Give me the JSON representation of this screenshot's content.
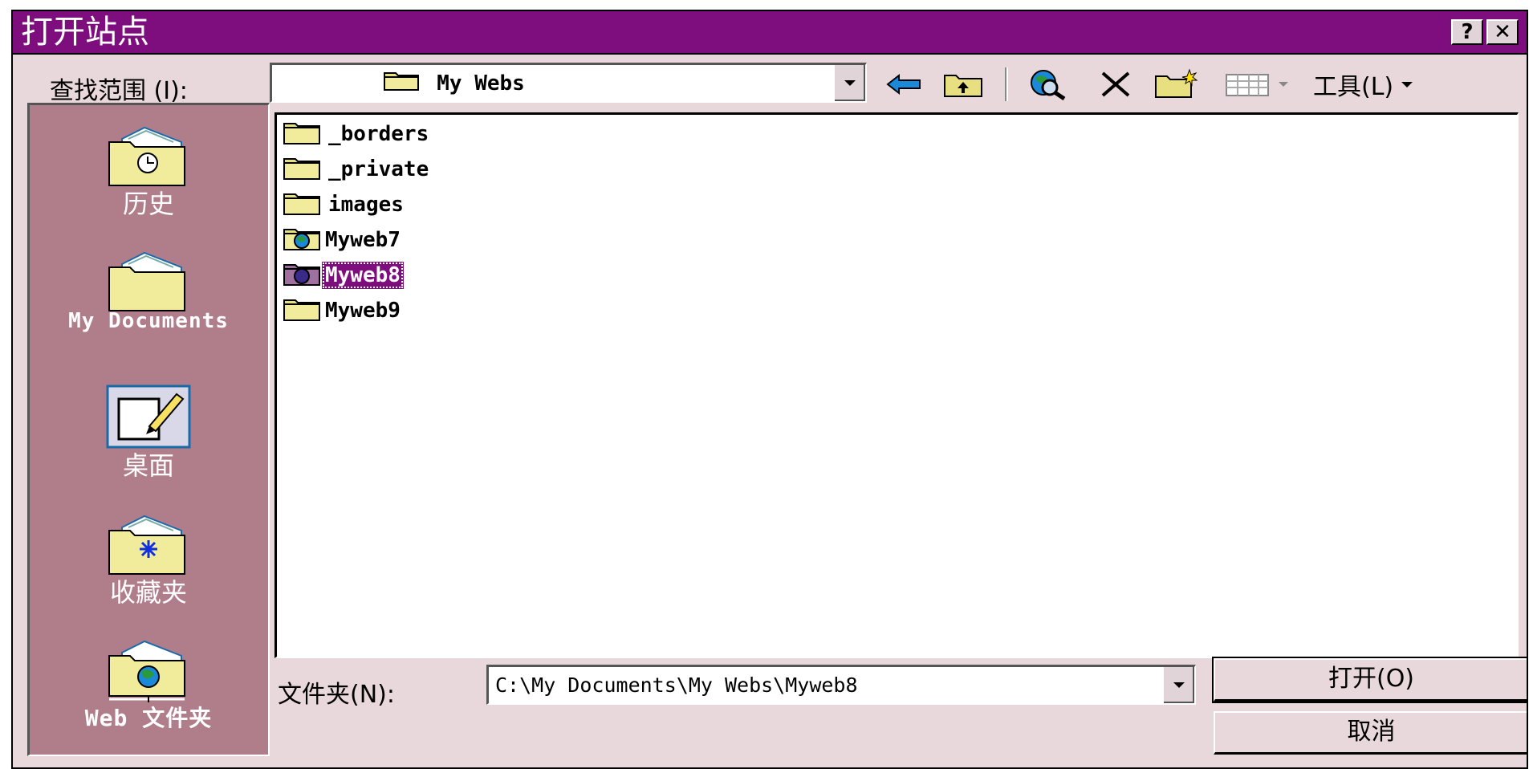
{
  "window": {
    "title": "打开站点",
    "help_button": "?",
    "close_button": "✕"
  },
  "lookin": {
    "label": "查找范围 (I):",
    "value": "My Webs"
  },
  "toolbar": {
    "tools_label": "工具(L)",
    "icons": [
      "back-arrow-icon",
      "up-folder-icon",
      "search-web-icon",
      "delete-icon",
      "new-folder-icon",
      "views-icon",
      "tools-dropdown-icon"
    ]
  },
  "places": {
    "history": "历史",
    "documents": "My Documents",
    "desktop": "桌面",
    "favorites": "收藏夹",
    "web_folders": "Web 文件夹"
  },
  "files": [
    {
      "name": "_borders",
      "icon": "folder-icon",
      "selected": false
    },
    {
      "name": "_private",
      "icon": "folder-icon",
      "selected": false
    },
    {
      "name": "images",
      "icon": "folder-icon",
      "selected": false
    },
    {
      "name": "Myweb7",
      "icon": "web-folder-icon",
      "selected": false
    },
    {
      "name": "Myweb8",
      "icon": "web-folder-icon",
      "selected": true
    },
    {
      "name": "Myweb9",
      "icon": "folder-icon",
      "selected": false
    }
  ],
  "folder_field": {
    "label": "文件夹(N):",
    "value": "C:\\My Documents\\My Webs\\Myweb8"
  },
  "buttons": {
    "open": "打开(O)",
    "cancel": "取消"
  },
  "colors": {
    "title_bar": "#7e0d7e",
    "dialog_bg": "#e8d8dc",
    "places_bg": "#b07e8a",
    "selection": "#7e0d7e"
  }
}
